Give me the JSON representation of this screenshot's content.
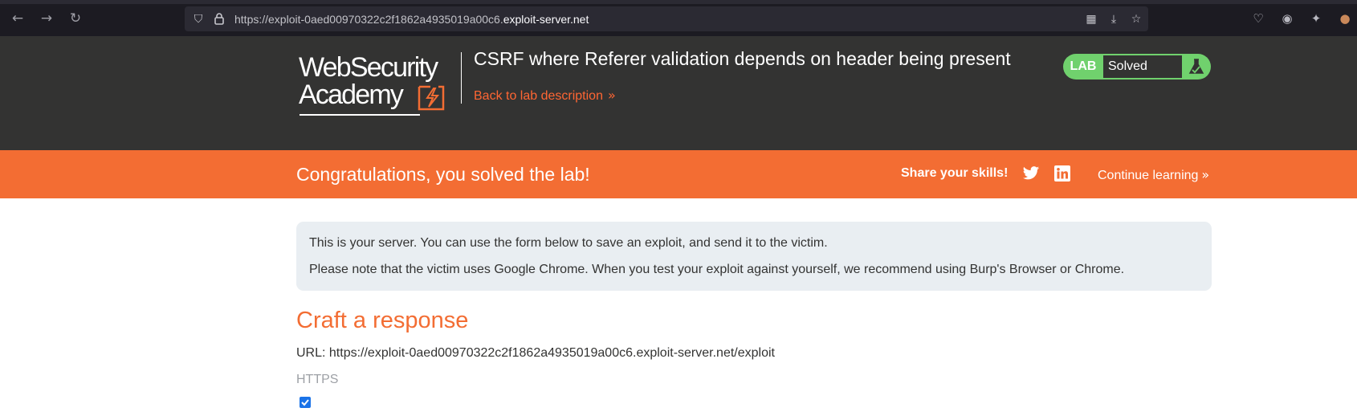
{
  "browser": {
    "url_prefix": "https://exploit-0aed00970322c2f1862a4935019a00c6.",
    "url_domain": "exploit-server.net"
  },
  "header": {
    "logo_line1": "WebSecurity",
    "logo_line2": "Academy",
    "lab_title": "CSRF where Referer validation depends on header being present",
    "back_link": "Back to lab description",
    "lab_tag": "LAB",
    "lab_status": "Solved"
  },
  "banner": {
    "message": "Congratulations, you solved the lab!",
    "share_label": "Share your skills!",
    "continue_label": "Continue learning"
  },
  "info": {
    "line1": "This is your server. You can use the form below to save an exploit, and send it to the victim.",
    "line2": "Please note that the victim uses Google Chrome. When you test your exploit against yourself, we recommend using Burp's Browser or Chrome."
  },
  "form": {
    "title": "Craft a response",
    "url_line": "URL: https://exploit-0aed00970322c2f1862a4935019a00c6.exploit-server.net/exploit",
    "https_label": "HTTPS",
    "https_checked": true
  },
  "colors": {
    "accent": "#f36d33",
    "header_bg": "#333332",
    "lab_green": "#70d16d"
  }
}
